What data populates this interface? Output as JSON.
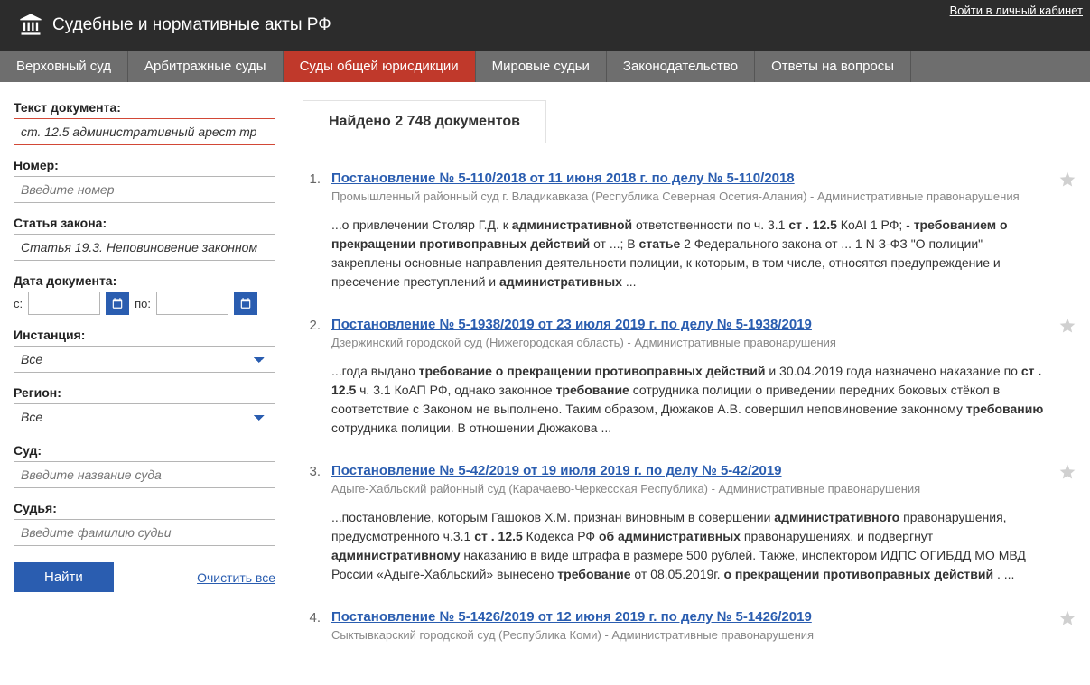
{
  "header": {
    "site_title": "Судебные и нормативные акты РФ",
    "login_link": "Войти в личный кабинет"
  },
  "nav": {
    "items": [
      {
        "label": "Верховный суд",
        "active": false
      },
      {
        "label": "Арбитражные суды",
        "active": false
      },
      {
        "label": "Суды общей юрисдикции",
        "active": true
      },
      {
        "label": "Мировые судьи",
        "active": false
      },
      {
        "label": "Законодательство",
        "active": false
      },
      {
        "label": "Ответы на вопросы",
        "active": false
      }
    ]
  },
  "search_form": {
    "text_label": "Текст документа:",
    "text_value": "ст. 12.5 административный арест тр",
    "number_label": "Номер:",
    "number_placeholder": "Введите номер",
    "law_article_label": "Статья закона:",
    "law_article_value": "Статья 19.3. Неповиновение законном",
    "doc_date_label": "Дата документа:",
    "date_from_label": "с:",
    "date_to_label": "по:",
    "instance_label": "Инстанция:",
    "instance_value": "Все",
    "region_label": "Регион:",
    "region_value": "Все",
    "court_label": "Суд:",
    "court_placeholder": "Введите название суда",
    "judge_label": "Судья:",
    "judge_placeholder": "Введите фамилию судьи",
    "search_button": "Найти",
    "clear_link": "Очистить все"
  },
  "results": {
    "found_text": "Найдено 2 748 документов",
    "items": [
      {
        "num": "1.",
        "title": "Постановление № 5-110/2018 от 11 июня 2018 г. по делу № 5-110/2018",
        "meta": "Промышленный районный суд г. Владикавказа (Республика Северная Осетия-Алания) - Административные правонарушения",
        "snippet": "...о привлечении Столяр Г.Д. к <b>административной</b> ответственности по ч. 3.1 <b>ст . 12.5</b> КоАІ 1 РФ; - <b>требованием о прекращении противоправных действий</b> от ...; В <b>статье</b> 2 Федерального закона от ... 1 N З-ФЗ \"О полиции\" закреплены основные направления деятельности полиции, к которым, в том числе, относятся предупреждение и пресечение преступлений и <b>административных</b> ..."
      },
      {
        "num": "2.",
        "title": "Постановление № 5-1938/2019 от 23 июля 2019 г. по делу № 5-1938/2019",
        "meta": "Дзержинский городской суд (Нижегородская область) - Административные правонарушения",
        "snippet": "...года выдано <b>требование о прекращении противоправных действий</b> и 30.04.2019 года назначено наказание по <b>ст . 12.5</b> ч. 3.1 КоАП РФ, однако законное <b>требование</b> сотрудника полиции о приведении передних боковых стёкол в соответствие с Законом не выполнено. Таким образом, Дюжаков А.В. совершил неповиновение законному <b>требованию</b> сотрудника полиции. В отношении Дюжакова ..."
      },
      {
        "num": "3.",
        "title": "Постановление № 5-42/2019 от 19 июля 2019 г. по делу № 5-42/2019",
        "meta": "Адыге-Хабльский районный суд (Карачаево-Черкесская Республика) - Административные правонарушения",
        "snippet": "...постановление, которым Гашоков Х.М. признан виновным в совершении <b>административного</b> правонарушения, предусмотренного ч.3.1 <b>ст . 12.5</b> Кодекса РФ <b>об административных</b> правонарушениях, и подвергнут <b>административному</b> наказанию в виде штрафа в размере 500 рублей. Также, инспектором ИДПС ОГИБДД МО МВД России «Адыге-Хабльский» вынесено <b>требование</b> от 08.05.2019г. <b>о прекращении противоправных действий</b> . ..."
      },
      {
        "num": "4.",
        "title": "Постановление № 5-1426/2019 от 12 июня 2019 г. по делу № 5-1426/2019",
        "meta": "Сыктывкарский городской суд (Республика Коми) - Административные правонарушения",
        "snippet": ""
      }
    ]
  }
}
